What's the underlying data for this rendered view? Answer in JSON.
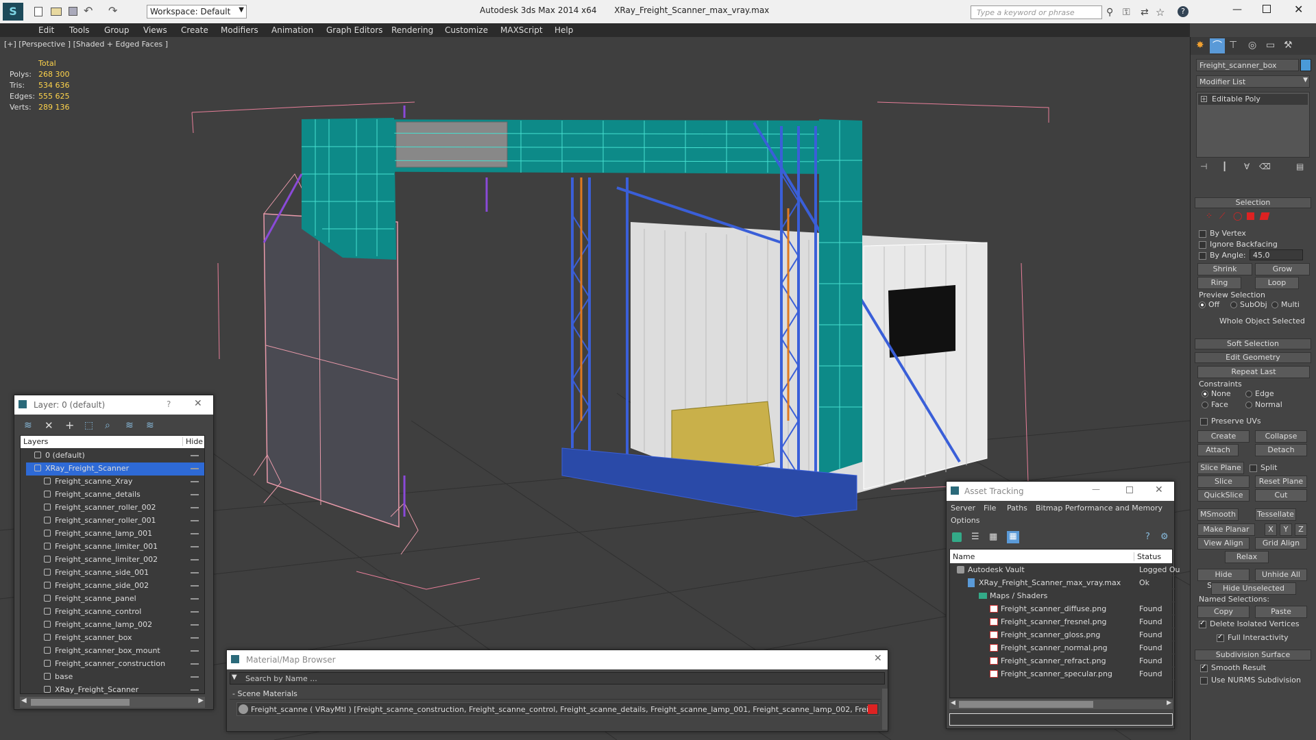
{
  "title": {
    "app": "Autodesk 3ds Max  2014 x64",
    "file": "XRay_Freight_Scanner_max_vray.max",
    "workspace": "Workspace: Default",
    "search_placeholder": "Type a keyword or phrase"
  },
  "menu": [
    "Edit",
    "Tools",
    "Group",
    "Views",
    "Create",
    "Modifiers",
    "Animation",
    "Graph Editors",
    "Rendering",
    "Customize",
    "MAXScript",
    "Help"
  ],
  "viewport": {
    "label": "[+] [Perspective ] [Shaded + Edged Faces ]",
    "stats": {
      "header": "Total",
      "rows": [
        {
          "k": "Polys:",
          "v": "268 300"
        },
        {
          "k": "Tris:",
          "v": "534 636"
        },
        {
          "k": "Edges:",
          "v": "555 625"
        },
        {
          "k": "Verts:",
          "v": "289 136"
        }
      ]
    }
  },
  "cmd": {
    "object_name": "Freight_scanner_box",
    "modifier_list": "Modifier List",
    "stack_item": "Editable Poly",
    "selection": "Selection",
    "by_vertex": "By Vertex",
    "ignore_backfacing": "Ignore Backfacing",
    "by_angle": "By Angle:",
    "angle_value": "45.0",
    "shrink": "Shrink",
    "grow": "Grow",
    "ring": "Ring",
    "loop": "Loop",
    "preview_selection": "Preview Selection",
    "off": "Off",
    "subobj": "SubObj",
    "multi": "Multi",
    "whole_object": "Whole Object Selected",
    "soft_selection": "Soft Selection",
    "edit_geometry": "Edit Geometry",
    "repeat_last": "Repeat Last",
    "constraints": "Constraints",
    "none": "None",
    "edge": "Edge",
    "face": "Face",
    "normal": "Normal",
    "preserve_uvs": "Preserve UVs",
    "create": "Create",
    "collapse": "Collapse",
    "attach": "Attach",
    "detach": "Detach",
    "slice_plane": "Slice Plane",
    "split": "Split",
    "slice": "Slice",
    "reset_plane": "Reset Plane",
    "quickslice": "QuickSlice",
    "cut": "Cut",
    "msmooth": "MSmooth",
    "tessellate": "Tessellate",
    "make_planar": "Make Planar",
    "x": "X",
    "y": "Y",
    "z": "Z",
    "view_align": "View Align",
    "grid_align": "Grid Align",
    "relax": "Relax",
    "hide_selected": "Hide Selected",
    "unhide_all": "Unhide All",
    "hide_unselected": "Hide Unselected",
    "named_selections": "Named Selections:",
    "copy": "Copy",
    "paste": "Paste",
    "delete_isolated": "Delete Isolated Vertices",
    "full_interactivity": "Full Interactivity",
    "subdivision_surface": "Subdivision Surface",
    "smooth_result": "Smooth Result",
    "use_nurms": "Use NURMS Subdivision"
  },
  "layers": {
    "title": "Layer: 0 (default)",
    "help": "?",
    "col_layers": "Layers",
    "col_hide": "Hide",
    "rows": [
      {
        "name": "0 (default)",
        "indent": 0,
        "type": "layer"
      },
      {
        "name": "XRay_Freight_Scanner",
        "indent": 0,
        "type": "layer",
        "selected": true
      },
      {
        "name": "Freight_scanne_Xray",
        "indent": 1,
        "type": "obj"
      },
      {
        "name": "Freight_scanne_details",
        "indent": 1,
        "type": "obj"
      },
      {
        "name": "Freight_scanner_roller_002",
        "indent": 1,
        "type": "obj"
      },
      {
        "name": "Freight_scanner_roller_001",
        "indent": 1,
        "type": "obj"
      },
      {
        "name": "Freight_scanne_lamp_001",
        "indent": 1,
        "type": "obj"
      },
      {
        "name": "Freight_scanne_limiter_001",
        "indent": 1,
        "type": "obj"
      },
      {
        "name": "Freight_scanne_limiter_002",
        "indent": 1,
        "type": "obj"
      },
      {
        "name": "Freight_scanne_side_001",
        "indent": 1,
        "type": "obj"
      },
      {
        "name": "Freight_scanne_side_002",
        "indent": 1,
        "type": "obj"
      },
      {
        "name": "Freight_scanne_panel",
        "indent": 1,
        "type": "obj"
      },
      {
        "name": "Freight_scanne_control",
        "indent": 1,
        "type": "obj"
      },
      {
        "name": "Freight_scanne_lamp_002",
        "indent": 1,
        "type": "obj"
      },
      {
        "name": "Freight_scanner_box",
        "indent": 1,
        "type": "obj"
      },
      {
        "name": "Freight_scanner_box_mount",
        "indent": 1,
        "type": "obj"
      },
      {
        "name": "Freight_scanner_construction",
        "indent": 1,
        "type": "obj"
      },
      {
        "name": "base",
        "indent": 1,
        "type": "obj"
      },
      {
        "name": "XRay_Freight_Scanner",
        "indent": 1,
        "type": "obj"
      }
    ]
  },
  "asset": {
    "title": "Asset Tracking",
    "menu": [
      "Server",
      "File",
      "Paths",
      "Bitmap Performance and Memory"
    ],
    "menu2": "Options",
    "col_name": "Name",
    "col_status": "Status",
    "rows": [
      {
        "name": "Autodesk Vault",
        "status": "Logged Ou",
        "indent": 0,
        "kind": "vault"
      },
      {
        "name": "XRay_Freight_Scanner_max_vray.max",
        "status": "Ok",
        "indent": 1,
        "kind": "max"
      },
      {
        "name": "Maps / Shaders",
        "status": "",
        "indent": 2,
        "kind": "folder"
      },
      {
        "name": "Freight_scanner_diffuse.png",
        "status": "Found",
        "indent": 3,
        "kind": "png"
      },
      {
        "name": "Freight_scanner_fresnel.png",
        "status": "Found",
        "indent": 3,
        "kind": "png"
      },
      {
        "name": "Freight_scanner_gloss.png",
        "status": "Found",
        "indent": 3,
        "kind": "png"
      },
      {
        "name": "Freight_scanner_normal.png",
        "status": "Found",
        "indent": 3,
        "kind": "png"
      },
      {
        "name": "Freight_scanner_refract.png",
        "status": "Found",
        "indent": 3,
        "kind": "png"
      },
      {
        "name": "Freight_scanner_specular.png",
        "status": "Found",
        "indent": 3,
        "kind": "png"
      }
    ]
  },
  "material": {
    "title": "Material/Map Browser",
    "search_placeholder": "Search by Name ...",
    "group": "- Scene Materials",
    "entry": "Freight_scanne ( VRayMtl ) [Freight_scanne_construction, Freight_scanne_control, Freight_scanne_details, Freight_scanne_lamp_001, Freight_scanne_lamp_002, Freight_scann..."
  }
}
